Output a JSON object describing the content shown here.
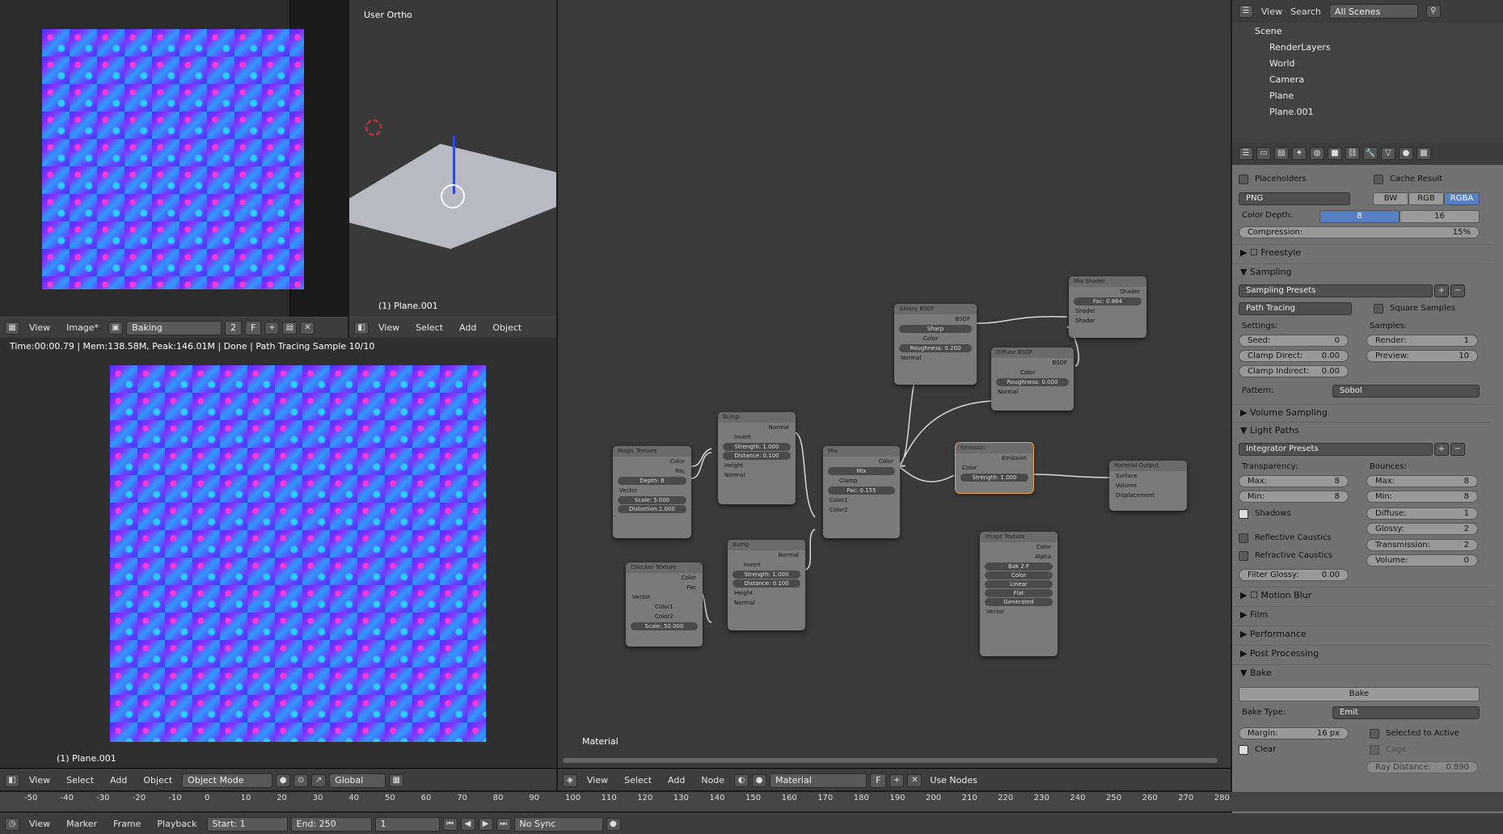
{
  "image_editor": {
    "menu": [
      "View",
      "Image*"
    ],
    "image_name": "Baking",
    "users": "2",
    "fake": "F"
  },
  "viewport3d": {
    "label": "User Ortho",
    "object": "(1) Plane.001",
    "menu": [
      "View",
      "Select",
      "Add",
      "Object"
    ]
  },
  "render": {
    "status": "Time:00:00.79 | Mem:138.58M, Peak:146.01M | Done | Path Tracing Sample 10/10",
    "object": "(1) Plane.001",
    "menu": [
      "View",
      "Select",
      "Add",
      "Object"
    ],
    "mode": "Object Mode",
    "orientation": "Global"
  },
  "node_editor": {
    "label": "Material",
    "menu": [
      "View",
      "Select",
      "Add",
      "Node"
    ],
    "material": "Material",
    "fake": "F",
    "use_nodes": "Use Nodes",
    "nodes": {
      "magic": {
        "title": "Magic Texture",
        "color": "Color",
        "fac": "Fac",
        "depth": "Depth:",
        "depth_v": "6",
        "vector": "Vector",
        "scale": "Scale:",
        "scale_v": "5.000",
        "distortion": "Distortion:",
        "distortion_v": "1.000"
      },
      "bump1": {
        "title": "Bump",
        "normal_out": "Normal",
        "invert": "Invert",
        "strength": "Strength:",
        "strength_v": "1.000",
        "distance": "Distance:",
        "distance_v": "0.100",
        "height": "Height",
        "normal": "Normal"
      },
      "checker": {
        "title": "Checker Texture",
        "color": "Color",
        "fac": "Fac",
        "vector": "Vector",
        "color1": "Color1",
        "color2": "Color2",
        "scale": "Scale:",
        "scale_v": "50.000"
      },
      "bump2": {
        "title": "Bump",
        "normal_out": "Normal",
        "invert": "Invert",
        "strength": "Strength:",
        "strength_v": "1.000",
        "distance": "Distance:",
        "distance_v": "0.100",
        "height": "Height",
        "normal": "Normal"
      },
      "mix": {
        "title": "Mix",
        "color": "Color",
        "mode": "Mix",
        "clamp": "Clamp",
        "fac": "Fac:",
        "fac_v": "0.155",
        "color1": "Color1",
        "color2": "Color2"
      },
      "glossy": {
        "title": "Glossy BSDF",
        "bsdf": "BSDF",
        "dist": "Sharp",
        "color": "Color",
        "roughness": "Roughness:",
        "roughness_v": "0.200",
        "normal": "Normal"
      },
      "diffuse": {
        "title": "Diffuse BSDF",
        "bsdf": "BSDF",
        "color": "Color",
        "roughness": "Roughness:",
        "roughness_v": "0.000",
        "normal": "Normal"
      },
      "mixshader": {
        "title": "Mix Shader",
        "shader_out": "Shader",
        "fac": "Fac:",
        "fac_v": "0.864",
        "shader1": "Shader",
        "shader2": "Shader"
      },
      "emission": {
        "title": "Emission",
        "emission": "Emission",
        "color": "Color",
        "strength": "Strength:",
        "strength_v": "1.000"
      },
      "output": {
        "title": "Material Output",
        "surface": "Surface",
        "volume": "Volume",
        "displacement": "Displacement"
      },
      "image": {
        "title": "Image Texture",
        "color": "Color",
        "alpha": "Alpha",
        "img": "Bak",
        "users": "2",
        "fake": "F",
        "cs": "Color",
        "interp": "Linear",
        "proj": "Flat",
        "ext": "Generated",
        "vector": "Vector"
      }
    }
  },
  "outliner": {
    "menu": [
      "View",
      "Search"
    ],
    "filter": "All Scenes",
    "items": [
      "Scene",
      "RenderLayers",
      "World",
      "Camera",
      "Plane",
      "Plane.001"
    ]
  },
  "properties": {
    "placeholders": "Placeholders",
    "cache_result": "Cache Result",
    "format": "PNG",
    "bw": "BW",
    "rgb": "RGB",
    "rgba": "RGBA",
    "color_depth": "Color Depth:",
    "cd8": "8",
    "cd16": "16",
    "compression": "Compression:",
    "compression_v": "15%",
    "sections": {
      "freestyle": "Freestyle",
      "sampling": "Sampling",
      "volume_sampling": "Volume Sampling",
      "light_paths": "Light Paths",
      "motion_blur": "Motion Blur",
      "film": "Film",
      "performance": "Performance",
      "post_processing": "Post Processing",
      "bake": "Bake"
    },
    "sampling_presets": "Sampling Presets",
    "integrator": "Path Tracing",
    "square_samples": "Square Samples",
    "settings": "Settings:",
    "samples": "Samples:",
    "seed": "Seed:",
    "seed_v": "0",
    "clamp_direct": "Clamp Direct:",
    "clamp_direct_v": "0.00",
    "clamp_indirect": "Clamp Indirect:",
    "clamp_indirect_v": "0.00",
    "render": "Render:",
    "render_v": "1",
    "preview": "Preview:",
    "preview_v": "10",
    "pattern": "Pattern:",
    "pattern_v": "Sobol",
    "integrator_presets": "Integrator Presets",
    "transparency": "Transparency:",
    "bounces": "Bounces:",
    "t_max": "Max:",
    "t_max_v": "8",
    "t_min": "Min:",
    "t_min_v": "8",
    "b_max": "Max:",
    "b_max_v": "8",
    "b_min": "Min:",
    "b_min_v": "8",
    "shadows": "Shadows",
    "diffuse": "Diffuse:",
    "diffuse_v": "1",
    "glossy": "Glossy:",
    "glossy_v": "2",
    "reflective": "Reflective Caustics",
    "transmission": "Transmission:",
    "transmission_v": "2",
    "refractive": "Refractive Caustics",
    "volume": "Volume:",
    "volume_v": "0",
    "filter_glossy": "Filter Glossy:",
    "filter_glossy_v": "0.00",
    "bake_btn": "Bake",
    "bake_type": "Bake Type:",
    "bake_type_v": "Emit",
    "margin": "Margin:",
    "margin_v": "16 px",
    "selected_to_active": "Selected to Active",
    "clear": "Clear",
    "cage": "Cage",
    "ray_distance": "Ray Distance:",
    "ray_distance_v": "0.890"
  },
  "timeline": {
    "menu": [
      "View",
      "Marker",
      "Frame",
      "Playback"
    ],
    "start": "Start:",
    "start_v": "1",
    "end": "End:",
    "end_v": "250",
    "current": "1",
    "sync": "No Sync",
    "ticks": [
      "-50",
      "-40",
      "-30",
      "-20",
      "-10",
      "0",
      "10",
      "20",
      "30",
      "40",
      "50",
      "60",
      "70",
      "80",
      "90",
      "100",
      "110",
      "120",
      "130",
      "140",
      "150",
      "160",
      "170",
      "180",
      "190",
      "200",
      "210",
      "220",
      "230",
      "240",
      "250",
      "260",
      "270",
      "280"
    ]
  }
}
